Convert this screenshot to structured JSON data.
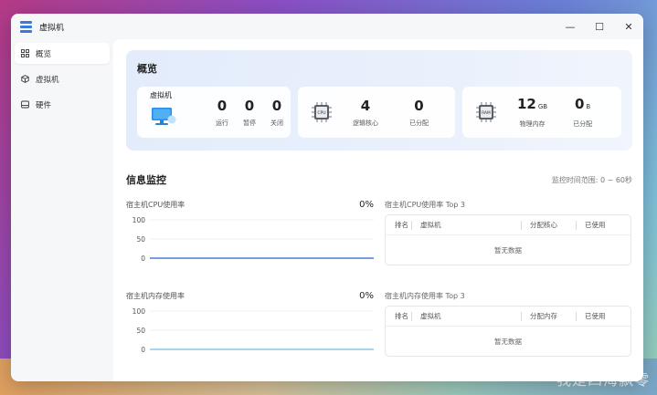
{
  "window": {
    "title": "虚拟机",
    "controls": {
      "minimize": "—",
      "maximize": "☐",
      "close": "✕"
    }
  },
  "sidebar": {
    "items": [
      {
        "label": "概览",
        "icon": "overview-grid-icon",
        "active": true
      },
      {
        "label": "虚拟机",
        "icon": "cube-icon",
        "active": false
      },
      {
        "label": "硬件",
        "icon": "drive-icon",
        "active": false
      }
    ]
  },
  "overview": {
    "title": "概览",
    "vm": {
      "label": "虚拟机",
      "running": {
        "value": "0",
        "label": "运行"
      },
      "paused": {
        "value": "0",
        "label": "暂停"
      },
      "stopped": {
        "value": "0",
        "label": "关闭"
      }
    },
    "cpu": {
      "badge": "CPU",
      "logical": {
        "value": "4",
        "label": "逻辑核心"
      },
      "allocated": {
        "value": "0",
        "label": "已分配"
      }
    },
    "memory": {
      "badge": "RAM",
      "physical": {
        "value": "12",
        "unit": "GB",
        "label": "物理内存"
      },
      "allocated": {
        "value": "0",
        "unit": "B",
        "label": "已分配"
      }
    }
  },
  "monitor": {
    "title": "信息监控",
    "range": "监控时间范围: 0 ~ 60秒",
    "cpu_chart": {
      "title": "宿主机CPU使用率",
      "current": "0%"
    },
    "mem_chart": {
      "title": "宿主机内存使用率",
      "current": "0%"
    },
    "cpu_table": {
      "title": "宿主机CPU使用率 Top 3",
      "columns": [
        "排名",
        "虚拟机",
        "分配核心",
        "已使用"
      ],
      "empty": "暂无数据"
    },
    "mem_table": {
      "title": "宿主机内存使用率 Top 3",
      "columns": [
        "排名",
        "虚拟机",
        "分配内存",
        "已使用"
      ],
      "empty": "暂无数据"
    }
  },
  "watermark": "我是四海飘零",
  "colors": {
    "accent": "#3e78d8",
    "cpu_line": "#4a7fd0",
    "mem_line": "#8ec7ec"
  },
  "chart_data": [
    {
      "type": "line",
      "title": "宿主机CPU使用率",
      "ylim": [
        0,
        100
      ],
      "yticks": [
        "100",
        "50",
        "0"
      ],
      "series": [
        {
          "values": [
            0,
            0
          ]
        }
      ]
    },
    {
      "type": "line",
      "title": "宿主机内存使用率",
      "ylim": [
        0,
        100
      ],
      "yticks": [
        "100",
        "50",
        "0"
      ],
      "series": [
        {
          "values": [
            0,
            0
          ]
        }
      ]
    }
  ]
}
